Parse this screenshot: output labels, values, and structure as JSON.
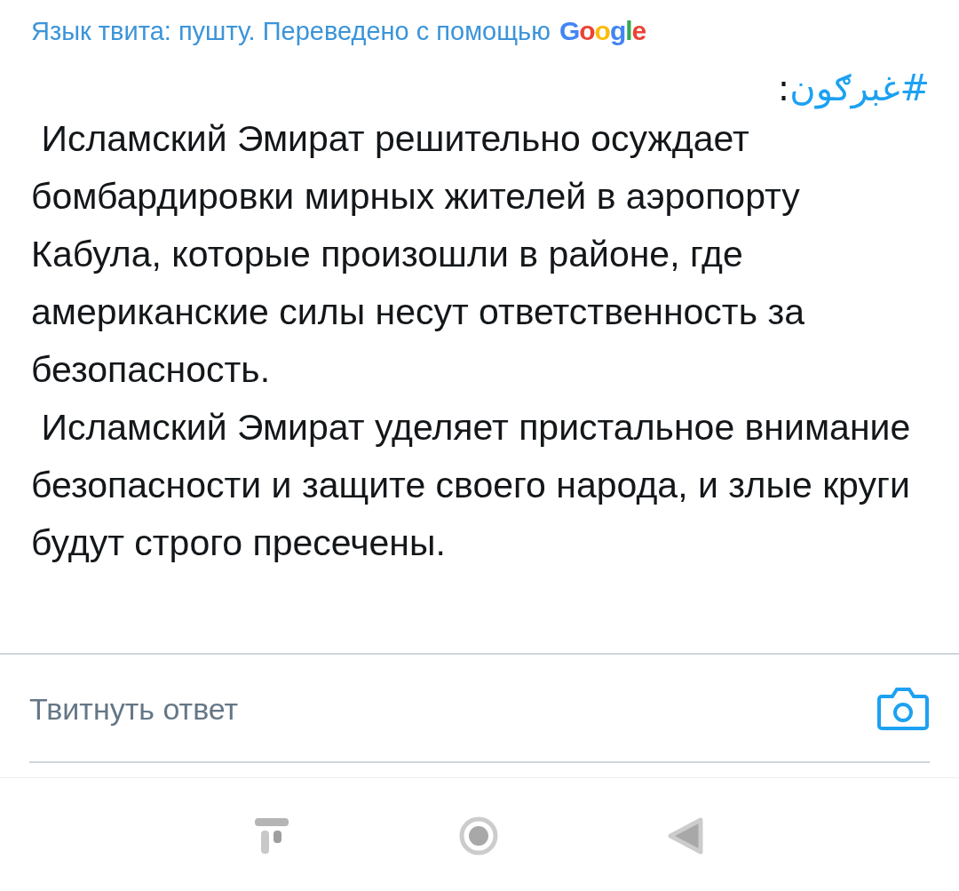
{
  "translation_note": {
    "text": "Язык твита: пушту. Переведено с помощью",
    "logo": "Google"
  },
  "hashtag_line": {
    "tag": "#غبرګون",
    "suffix": ":"
  },
  "paragraphs": [
    " Исламский Эмират решительно осуждает бомбардировки мирных жителей в аэропорту Кабула, которые произошли в районе, где американские силы несут ответственность за безопасность.",
    " Исламский Эмират уделяет пристальное внимание безопасности и защите своего народа, и злые круги будут строго пресечены."
  ],
  "reply": {
    "placeholder": "Твитнуть ответ"
  }
}
